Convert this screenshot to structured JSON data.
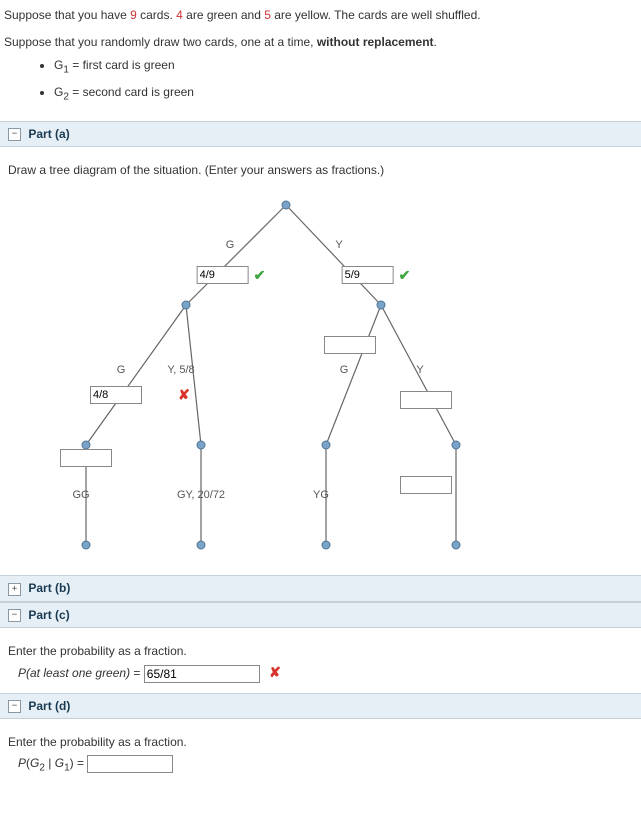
{
  "intro": {
    "line1_a": "Suppose that you have ",
    "line1_b": " cards. ",
    "line1_c": " are green and ",
    "line1_d": " are yellow. The cards are well shuffled.",
    "num_total": "9",
    "num_green": "4",
    "num_yellow": "5",
    "line2_a": "Suppose that you randomly draw two cards, one at a time, ",
    "line2_b": "without replacement",
    "line2_c": ".",
    "g1_def": " = first card is green",
    "g2_def": " = second card is green",
    "g1_sym": "G",
    "g1_sub": "1",
    "g2_sym": "G",
    "g2_sub": "2"
  },
  "part_a": {
    "header": "Part (a)",
    "instruction": "Draw a tree diagram of the situation. (Enter your answers as fractions.)",
    "labels": {
      "G_top_left": "G",
      "Y_top_right": "Y",
      "G_left": "G",
      "Y_mid_left": "Y, 5/8",
      "G_right": "G",
      "Y_right": "Y",
      "GG": "GG",
      "GY": "GY, 20/72",
      "YG": "YG"
    },
    "inputs": {
      "first_G": "4/9",
      "first_Y": "5/9",
      "gg_branch": "4/8",
      "gy_branch": "",
      "yg_branch": "",
      "yy_branch": "",
      "gg_leaf": "",
      "yy_leaf": ""
    }
  },
  "part_b": {
    "header": "Part (b)"
  },
  "part_c": {
    "header": "Part (c)",
    "instruction": "Enter the probability as a fraction.",
    "label_a": "P",
    "label_b": "(at least one green)",
    "equals": " = ",
    "value": "65/81"
  },
  "part_d": {
    "header": "Part (d)",
    "instruction": "Enter the probability as a fraction.",
    "label_a": "P",
    "label_paren_open": "(",
    "label_g2": "G",
    "label_g2_sub": "2",
    "label_bar": " | ",
    "label_g1": "G",
    "label_g1_sub": "1",
    "label_paren_close": ")",
    "equals": " = ",
    "value": ""
  }
}
